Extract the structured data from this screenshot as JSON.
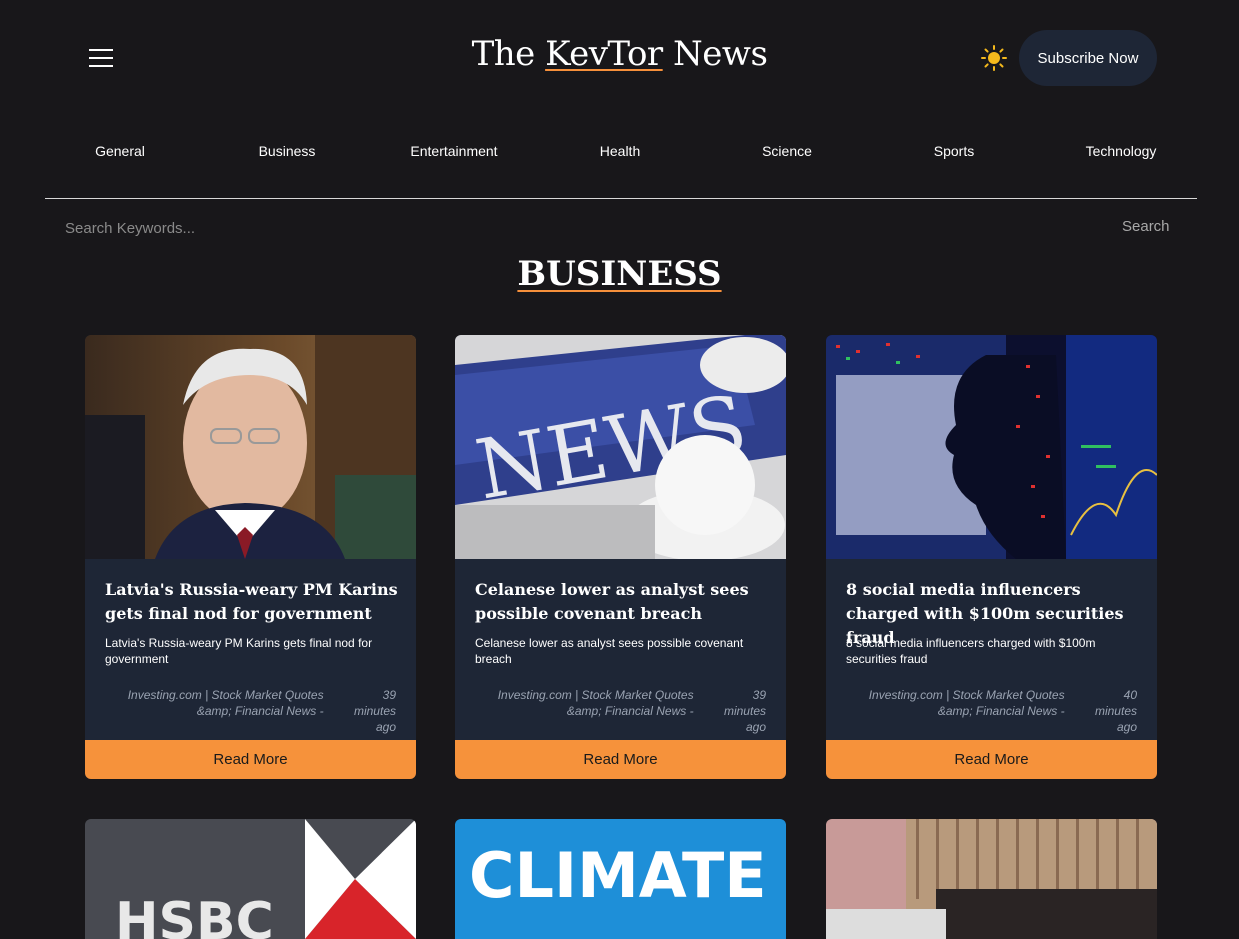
{
  "header": {
    "logo_prefix": "The ",
    "logo_accent": "KevTor",
    "logo_suffix": " News",
    "subscribe_label": "Subscribe Now"
  },
  "nav": [
    {
      "label": "General"
    },
    {
      "label": "Business"
    },
    {
      "label": "Entertainment"
    },
    {
      "label": "Health"
    },
    {
      "label": "Science"
    },
    {
      "label": "Sports"
    },
    {
      "label": "Technology"
    }
  ],
  "search": {
    "placeholder": "Search Keywords...",
    "button_label": "Search"
  },
  "section_title": "BUSINESS",
  "articles": [
    {
      "title": "Latvia's Russia-weary PM Karins gets final nod for government",
      "description": "Latvia's Russia-weary PM Karins gets final nod for government",
      "source": "Investing.com | Stock Market Quotes &amp; Financial News -",
      "time": "39 minutes ago",
      "read_more": "Read More"
    },
    {
      "title": "Celanese lower as analyst sees possible covenant breach",
      "description": "Celanese lower as analyst sees possible covenant breach",
      "source": "Investing.com | Stock Market Quotes &amp; Financial News -",
      "time": "39 minutes ago",
      "read_more": "Read More"
    },
    {
      "title": "8 social media influencers charged with $100m securities fraud",
      "description": "8 social media influencers charged with $100m securities fraud",
      "source": "Investing.com | Stock Market Quotes &amp; Financial News -",
      "time": "40 minutes ago",
      "read_more": "Read More"
    }
  ],
  "second_row_images": [
    {
      "text": "HSBC"
    },
    {
      "text": "CLIMATE"
    },
    {
      "text": ""
    }
  ],
  "colors": {
    "background": "#18171a",
    "card": "#1e2636",
    "accent": "#f6923b",
    "subscribe_bg": "#1e2636"
  },
  "icons": [
    "hamburger-menu-icon",
    "sun-icon"
  ]
}
